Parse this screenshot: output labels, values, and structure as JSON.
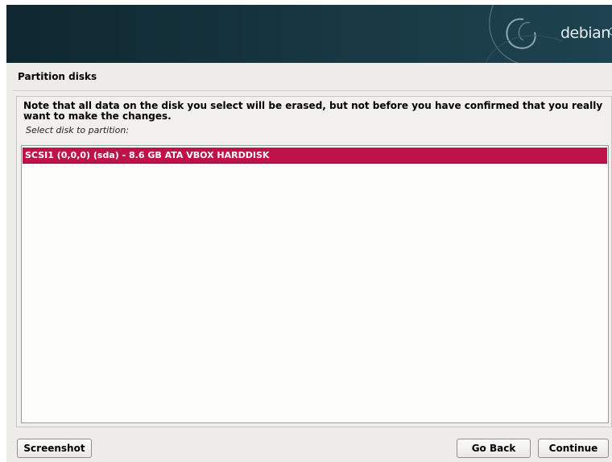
{
  "banner": {
    "logo_text": "debian"
  },
  "page": {
    "title": "Partition disks"
  },
  "content": {
    "note": "Note that all data on the disk you select will be erased, but not before you have confirmed that you really want to make the changes.",
    "prompt": "Select disk to partition:",
    "disks": [
      {
        "label": "SCSI1 (0,0,0) (sda) - 8.6 GB ATA VBOX HARDDISK",
        "selected": true
      }
    ]
  },
  "buttons": {
    "screenshot": "Screenshot",
    "go_back": "Go Back",
    "continue": "Continue"
  },
  "colors": {
    "selection": "#c0124a",
    "banner": "#15333d",
    "panel": "#edece9"
  },
  "icons": {
    "logo": "debian-swirl-icon"
  }
}
